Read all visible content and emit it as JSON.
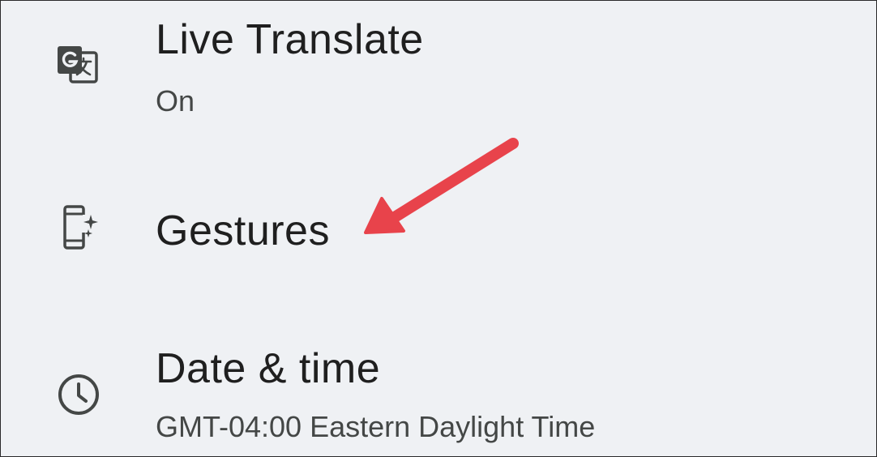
{
  "settings_list": {
    "items": [
      {
        "title": "Live Translate",
        "subtitle": "On",
        "icon": "translate-icon"
      },
      {
        "title": "Gestures",
        "icon": "phone-sparkle-icon"
      },
      {
        "title": "Date & time",
        "subtitle": "GMT-04:00 Eastern Daylight Time",
        "icon": "clock-icon"
      }
    ]
  },
  "annotation": {
    "arrow_color": "#e8434b",
    "points_to": "Gestures"
  },
  "colors": {
    "background": "#eff1f4",
    "title_text": "#1f1f1f",
    "subtitle_text": "#444746",
    "icon": "#444746"
  }
}
